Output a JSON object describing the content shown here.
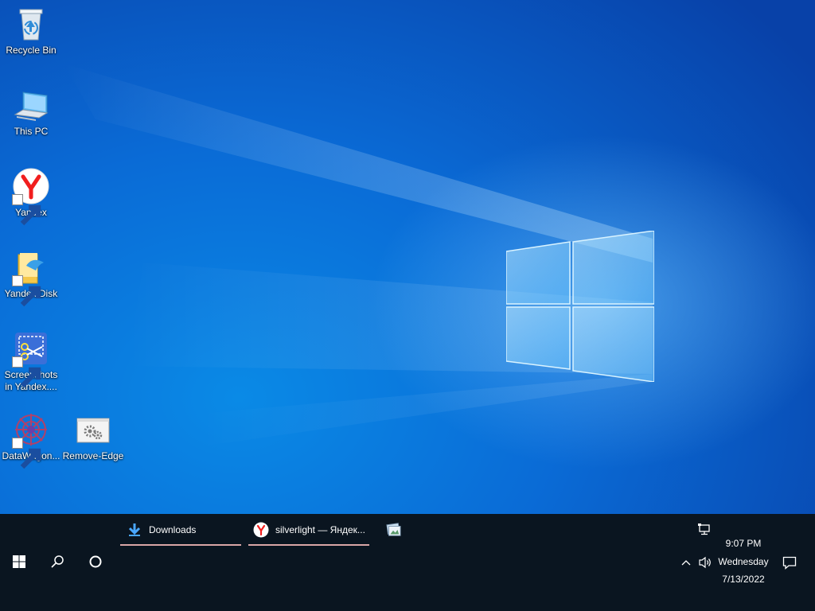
{
  "desktop": {
    "icons": [
      {
        "id": "recycle-bin",
        "label": "Recycle Bin",
        "icon": "recycle-bin-icon",
        "shortcut": false
      },
      {
        "id": "this-pc",
        "label": "This PC",
        "icon": "computer-icon",
        "shortcut": false
      },
      {
        "id": "yandex",
        "label": "Yandex",
        "icon": "yandex-browser-icon",
        "shortcut": true
      },
      {
        "id": "yandex-disk",
        "label": "Yandex.Disk",
        "icon": "yandex-disk-folder-icon",
        "shortcut": true
      },
      {
        "id": "screenshots",
        "label": "Screenshots in Yandex....",
        "icon": "scissors-screenshot-icon",
        "shortcut": true
      },
      {
        "id": "datawagon",
        "label": "DataWagon...",
        "icon": "datawagon-icon",
        "shortcut": true
      },
      {
        "id": "remove-edge",
        "label": "Remove-Edge",
        "icon": "gears-script-icon",
        "shortcut": false
      }
    ]
  },
  "taskbar": {
    "start_icon": "windows-start-icon",
    "search_icon": "search-icon",
    "cortana_icon": "cortana-circle-icon",
    "apps": [
      {
        "label": "Downloads",
        "icon": "download-arrow-icon"
      },
      {
        "label": "silverlight — Яндек...",
        "icon": "yandex-browser-icon"
      },
      {
        "label": "",
        "icon": "image-viewer-icon"
      }
    ],
    "tray": {
      "network_icon": "network-icon",
      "chevron_icon": "chevron-up-icon",
      "volume_icon": "volume-icon",
      "time": "9:07 PM",
      "day": "Wednesday",
      "date": "7/13/2022",
      "notification_icon": "notification-icon"
    }
  },
  "colors": {
    "taskbar": "#0a1520",
    "accent": "#0a6bd6",
    "underline": "#d9a6a6"
  }
}
